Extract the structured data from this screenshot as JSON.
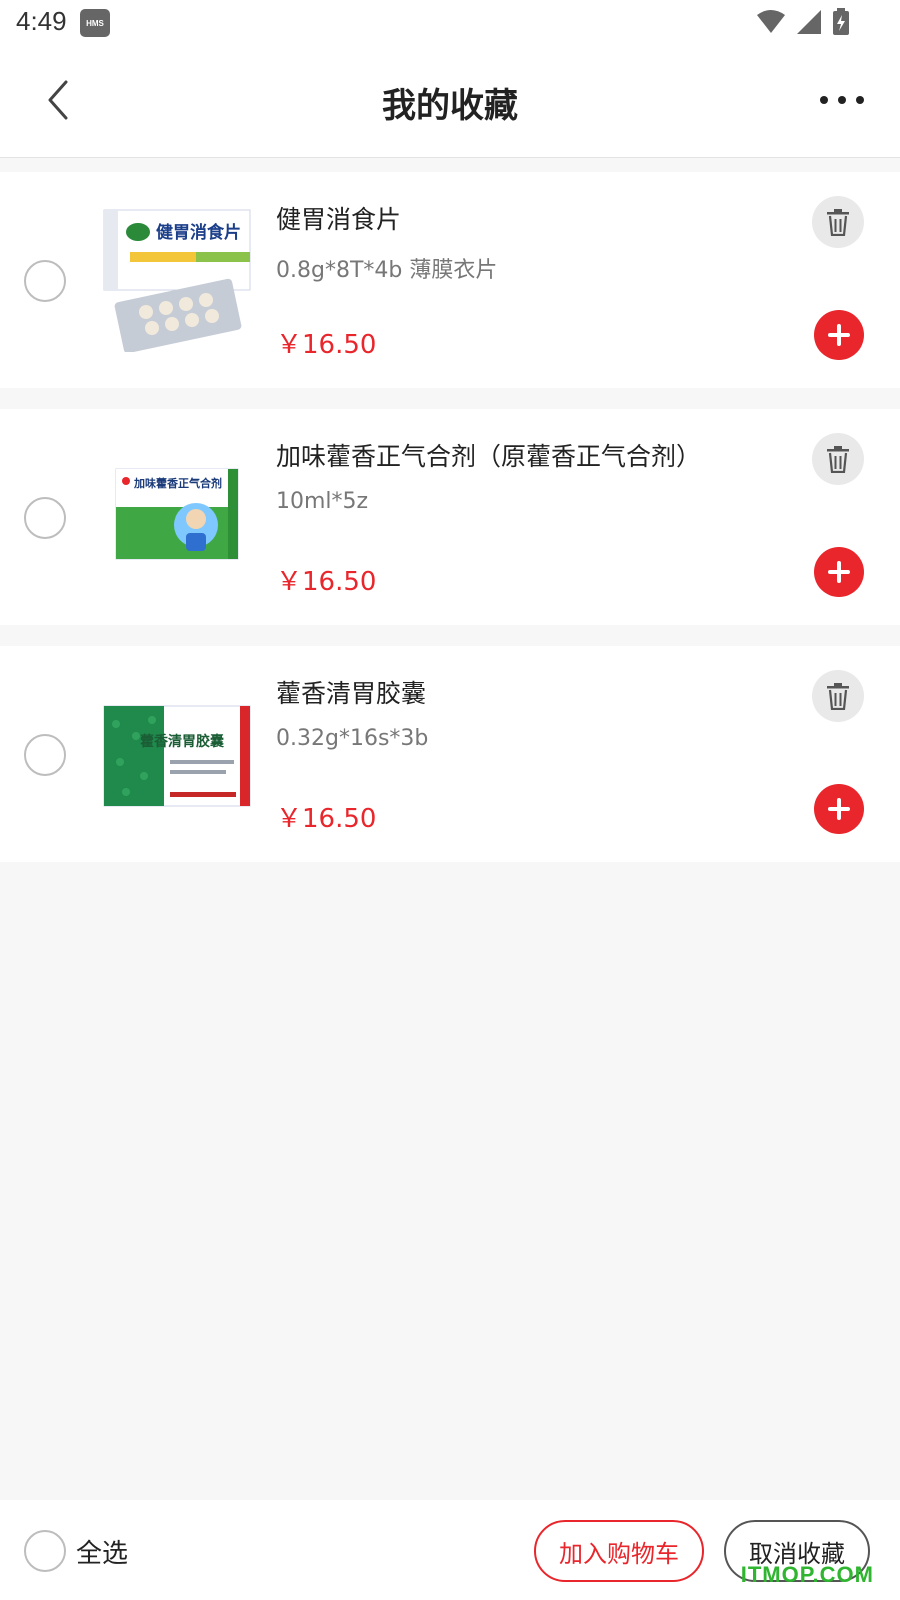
{
  "status": {
    "time": "4:49",
    "hms": "HMS"
  },
  "header": {
    "title": "我的收藏"
  },
  "items": [
    {
      "name": "健胃消食片",
      "spec": "0.8g*8T*4b  薄膜衣片",
      "price": "￥16.50",
      "box_text": "健胃消食片"
    },
    {
      "name": "加味藿香正气合剂（原藿香正气合剂）",
      "spec": "10ml*5z",
      "price": "￥16.50",
      "box_text": "加味藿香正气合剂"
    },
    {
      "name": "藿香清胃胶囊",
      "spec": "0.32g*16s*3b",
      "price": "￥16.50",
      "box_text": "藿香清胃胶囊"
    }
  ],
  "bottom": {
    "select_all": "全选",
    "add_to_cart": "加入购物车",
    "cancel_favorite": "取消收藏"
  },
  "watermark": "ITMOP.COM",
  "colors": {
    "accent": "#e8262b",
    "watermark": "#2fb52f"
  }
}
